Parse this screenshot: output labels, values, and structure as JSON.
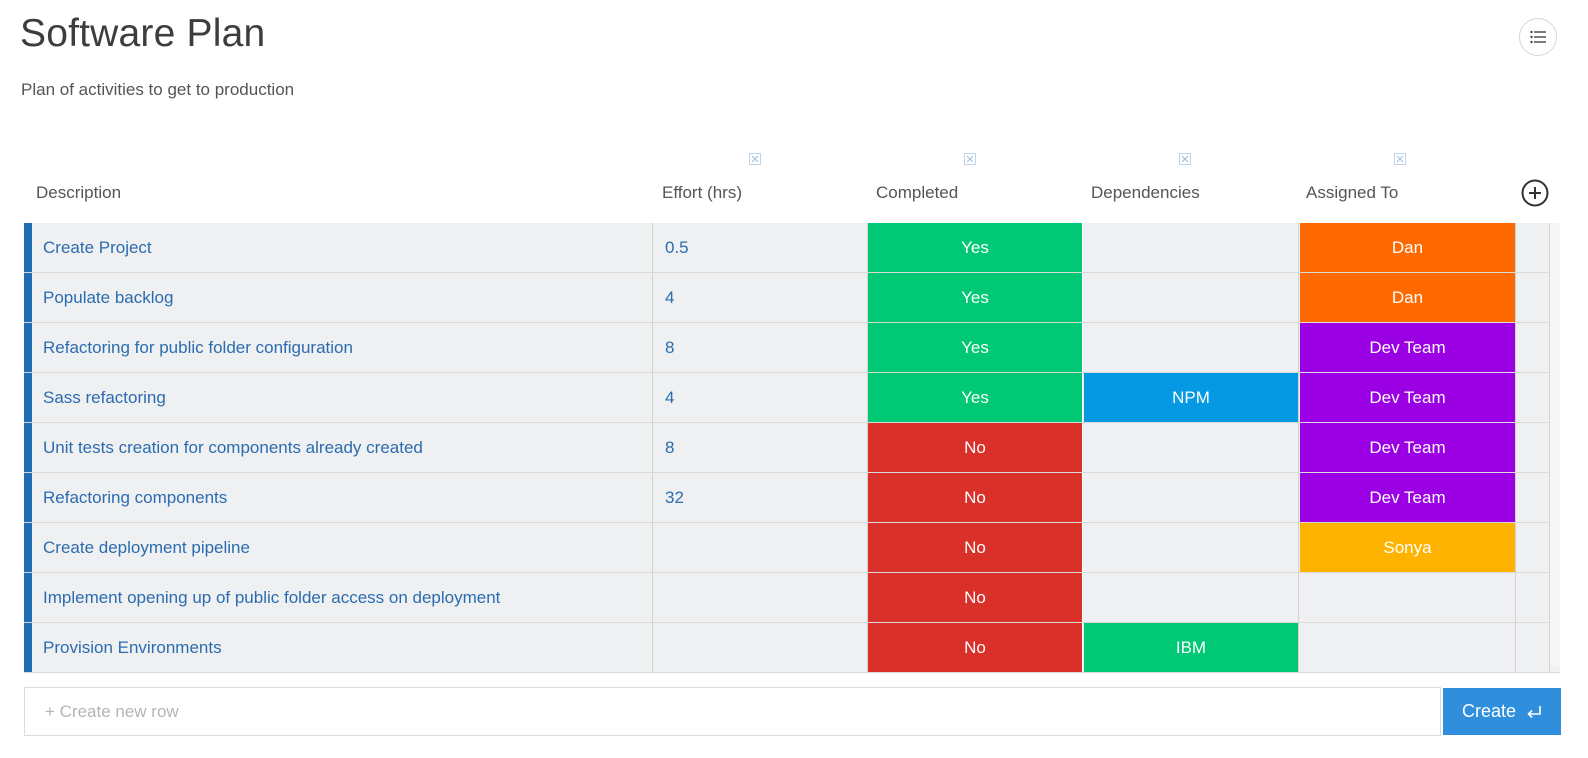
{
  "header": {
    "title": "Software Plan",
    "subtitle": "Plan of activities to get to production",
    "menu_icon": "list-icon"
  },
  "colors": {
    "accent_bar": "#1f6db3",
    "yes": "#00c875",
    "no": "#d9312a",
    "npm": "#0599e4",
    "ibm": "#00c875",
    "dan": "#ff6a00",
    "dev_team": "#9b00e5",
    "sonya": "#fdb300",
    "create_button": "#2f8fdc",
    "link_text": "#2b6cb0"
  },
  "table": {
    "columns": [
      {
        "label": "Description"
      },
      {
        "label": "Effort (hrs)"
      },
      {
        "label": "Completed"
      },
      {
        "label": "Dependencies"
      },
      {
        "label": "Assigned To"
      }
    ],
    "rows": [
      {
        "description": "Create Project",
        "effort": "0.5",
        "completed": "Yes",
        "dependencies": "",
        "assigned": "Dan"
      },
      {
        "description": "Populate backlog",
        "effort": "4",
        "completed": "Yes",
        "dependencies": "",
        "assigned": "Dan"
      },
      {
        "description": "Refactoring for public folder configuration",
        "effort": "8",
        "completed": "Yes",
        "dependencies": "",
        "assigned": "Dev Team"
      },
      {
        "description": "Sass refactoring",
        "effort": "4",
        "completed": "Yes",
        "dependencies": "NPM",
        "assigned": "Dev Team"
      },
      {
        "description": "Unit tests creation for components already created",
        "effort": "8",
        "completed": "No",
        "dependencies": "",
        "assigned": "Dev Team"
      },
      {
        "description": "Refactoring components",
        "effort": "32",
        "completed": "No",
        "dependencies": "",
        "assigned": "Dev Team"
      },
      {
        "description": "Create deployment pipeline",
        "effort": "",
        "completed": "No",
        "dependencies": "",
        "assigned": "Sonya"
      },
      {
        "description": "Implement opening up of public folder access on deployment",
        "effort": "",
        "completed": "No",
        "dependencies": "",
        "assigned": ""
      },
      {
        "description": "Provision Environments",
        "effort": "",
        "completed": "No",
        "dependencies": "IBM",
        "assigned": ""
      }
    ]
  },
  "new_row": {
    "placeholder": "+ Create new row",
    "value": "",
    "button_label": "Create",
    "button_icon": "enter-icon"
  }
}
